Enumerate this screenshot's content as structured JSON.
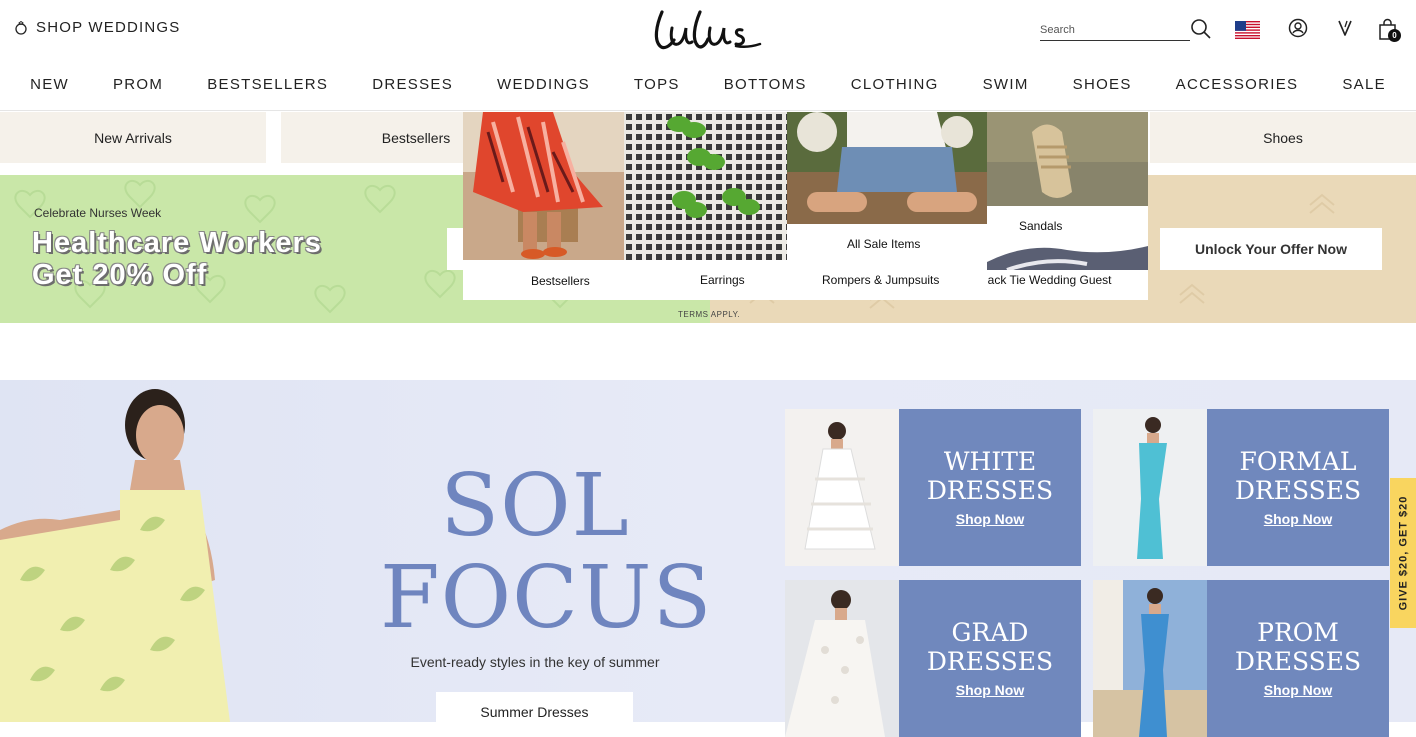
{
  "header": {
    "shop_weddings": "SHOP WEDDINGS",
    "search_placeholder": "Search",
    "bag_count": "0"
  },
  "nav": [
    "NEW",
    "PROM",
    "BESTSELLERS",
    "DRESSES",
    "WEDDINGS",
    "TOPS",
    "BOTTOMS",
    "CLOTHING",
    "SWIM",
    "SHOES",
    "ACCESSORIES",
    "SALE"
  ],
  "subcats": {
    "new_arrivals": "New Arrivals",
    "bestsellers": "Bestsellers",
    "shoes": "Shoes"
  },
  "promo": {
    "small": "Celebrate Nurses Week",
    "headline_1": "Healthcare Workers",
    "headline_2": "Get 20% Off",
    "cta": "Unlock Your Offer Now",
    "terms": "TERMS APPLY."
  },
  "mega_menu": {
    "bestsellers": "Bestsellers",
    "earrings": "Earrings",
    "all_sale": "All Sale Items",
    "rompers": "Rompers & Jumpsuits",
    "sandals": "Sandals",
    "black_tie": "lack Tie Wedding Guest"
  },
  "hero": {
    "title_1": "SOL",
    "title_2": "FOCUS",
    "tagline": "Event-ready styles in the key of summer",
    "cta": "Summer Dresses",
    "cards": [
      {
        "l1": "WHITE",
        "l2": "DRESSES",
        "shop": "Shop Now"
      },
      {
        "l1": "FORMAL",
        "l2": "DRESSES",
        "shop": "Shop Now"
      },
      {
        "l1": "GRAD",
        "l2": "DRESSES",
        "shop": "Shop Now"
      },
      {
        "l1": "PROM",
        "l2": "DRESSES",
        "shop": "Shop Now"
      }
    ]
  },
  "side_tab": "GIVE $20, GET $20",
  "colors": {
    "accent_blue": "#7088bd",
    "promo_green": "#c9e7a8",
    "promo_tan": "#ead9b8",
    "side_tab": "#f9d55f"
  }
}
